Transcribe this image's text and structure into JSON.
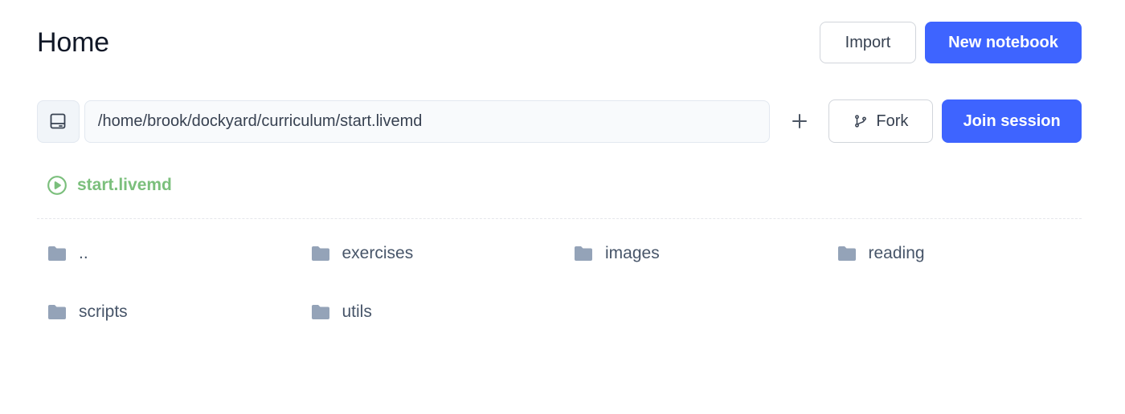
{
  "header": {
    "title": "Home",
    "import_label": "Import",
    "new_notebook_label": "New notebook"
  },
  "path_bar": {
    "path_value": "/home/brook/dockyard/curriculum/start.livemd",
    "disk_icon": "hard-drive-icon",
    "plus_icon": "plus-icon",
    "fork_label": "Fork",
    "fork_icon": "git-branch-icon",
    "join_label": "Join session"
  },
  "running": {
    "label": "start.livemd",
    "icon": "play-circle-icon",
    "color": "#7bbf7c"
  },
  "files": [
    {
      "name": "..",
      "icon": "folder-icon"
    },
    {
      "name": "exercises",
      "icon": "folder-icon"
    },
    {
      "name": "images",
      "icon": "folder-icon"
    },
    {
      "name": "reading",
      "icon": "folder-icon"
    },
    {
      "name": "scripts",
      "icon": "folder-icon"
    },
    {
      "name": "utils",
      "icon": "folder-icon"
    }
  ],
  "colors": {
    "accent": "#3e64ff",
    "folder": "#94a3b8",
    "running": "#7bbf7c"
  }
}
